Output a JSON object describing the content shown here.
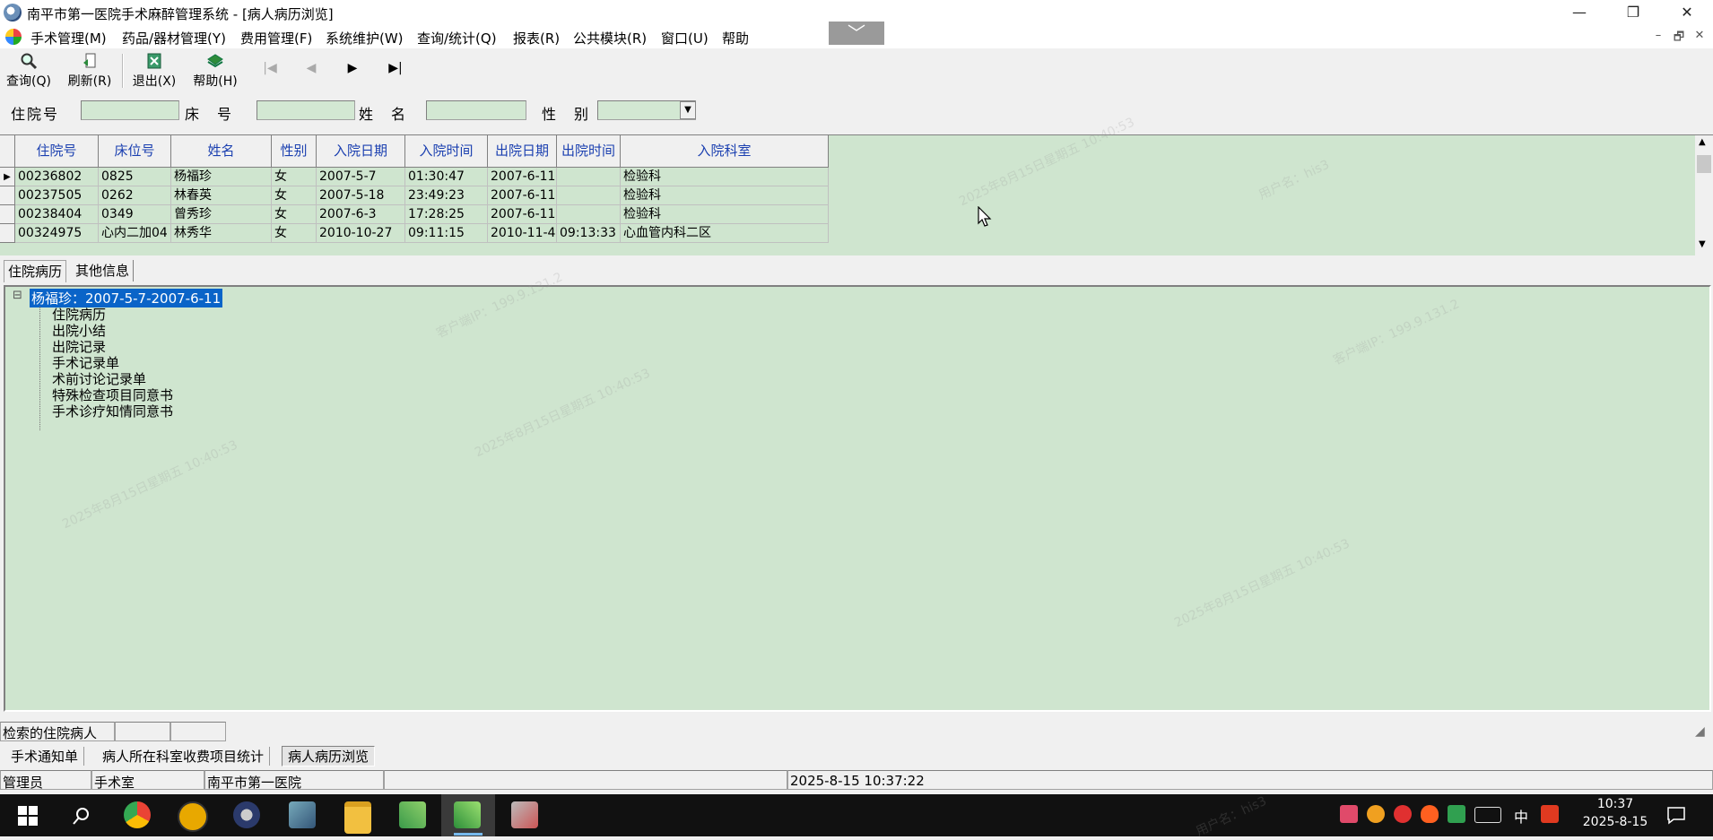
{
  "window": {
    "title": "南平市第一医院手术麻醉管理系统 - [病人病历浏览]",
    "minimize": "—",
    "restore": "❐",
    "close": "✕"
  },
  "menu": [
    "手术管理(M)",
    "药品/器材管理(Y)",
    "费用管理(F)",
    "系统维护(W)",
    "查询/统计(Q)",
    "报表(R)",
    "公共模块(R)",
    "窗口(U)",
    "帮助"
  ],
  "mdi_controls": {
    "minimize": "–",
    "restore": "🗗",
    "close": "✕"
  },
  "toolbar": {
    "query": "查询(Q)",
    "refresh": "刷新(R)",
    "exit": "退出(X)",
    "help": "帮助(H)",
    "nav_first": "|◀",
    "nav_prev": "◀",
    "nav_next": "▶",
    "nav_last": "▶|"
  },
  "search": {
    "admission_no_label": "住院号",
    "bed_label": "床　号",
    "name_label": "姓　名",
    "gender_label": "性　别",
    "admission_no_value": "",
    "bed_value": "",
    "name_value": "",
    "gender_value": ""
  },
  "grid": {
    "columns": [
      "住院号",
      "床位号",
      "姓名",
      "性别",
      "入院日期",
      "入院时间",
      "出院日期",
      "出院时间",
      "入院科室"
    ],
    "rows": [
      [
        "00236802",
        "0825",
        "杨福珍",
        "女",
        "2007-5-7",
        "01:30:47",
        "2007-6-11",
        "",
        "检验科"
      ],
      [
        "00237505",
        "0262",
        "林春英",
        "女",
        "2007-5-18",
        "23:49:23",
        "2007-6-11",
        "",
        "检验科"
      ],
      [
        "00238404",
        "0349",
        "曾秀珍",
        "女",
        "2007-6-3",
        "17:28:25",
        "2007-6-11",
        "",
        "检验科"
      ],
      [
        "00324975",
        "心内二加04",
        "林秀华",
        "女",
        "2010-10-27",
        "09:11:15",
        "2010-11-4",
        "09:13:33",
        "心血管内科二区"
      ]
    ],
    "current_row_marker": "▶"
  },
  "tabs": [
    "住院病历",
    "其他信息"
  ],
  "tree": {
    "expander": "⊟",
    "root": "杨福珍：2007-5-7-2007-6-11",
    "children": [
      "住院病历",
      "出院小结",
      "出院记录",
      "手术记录单",
      "术前讨论记录单",
      "特殊检查项目同意书",
      "手术诊疗知情同意书"
    ]
  },
  "status": {
    "search_caption": "检索的住院病人"
  },
  "window_tabs": [
    "手术通知单",
    "病人所在科室收费项目统计",
    "病人病历浏览"
  ],
  "statusbar": {
    "user": "管理员",
    "dept": "手术室",
    "hospital": "南平市第一医院",
    "datetime": "2025-8-15 10:37:22"
  },
  "taskbar": {
    "time": "10:37",
    "date": "2025-8-15",
    "ime": "中"
  },
  "watermark": {
    "user": "用户名：his3",
    "date": "2025年8月15日星期五 10:40:53",
    "ip": "客户端IP：199.9.131.2"
  },
  "colors": {
    "grid_bg": "#cfe5cf",
    "header_text": "#1a3fb0",
    "selection": "#0a64c8",
    "taskbar": "#111111"
  }
}
